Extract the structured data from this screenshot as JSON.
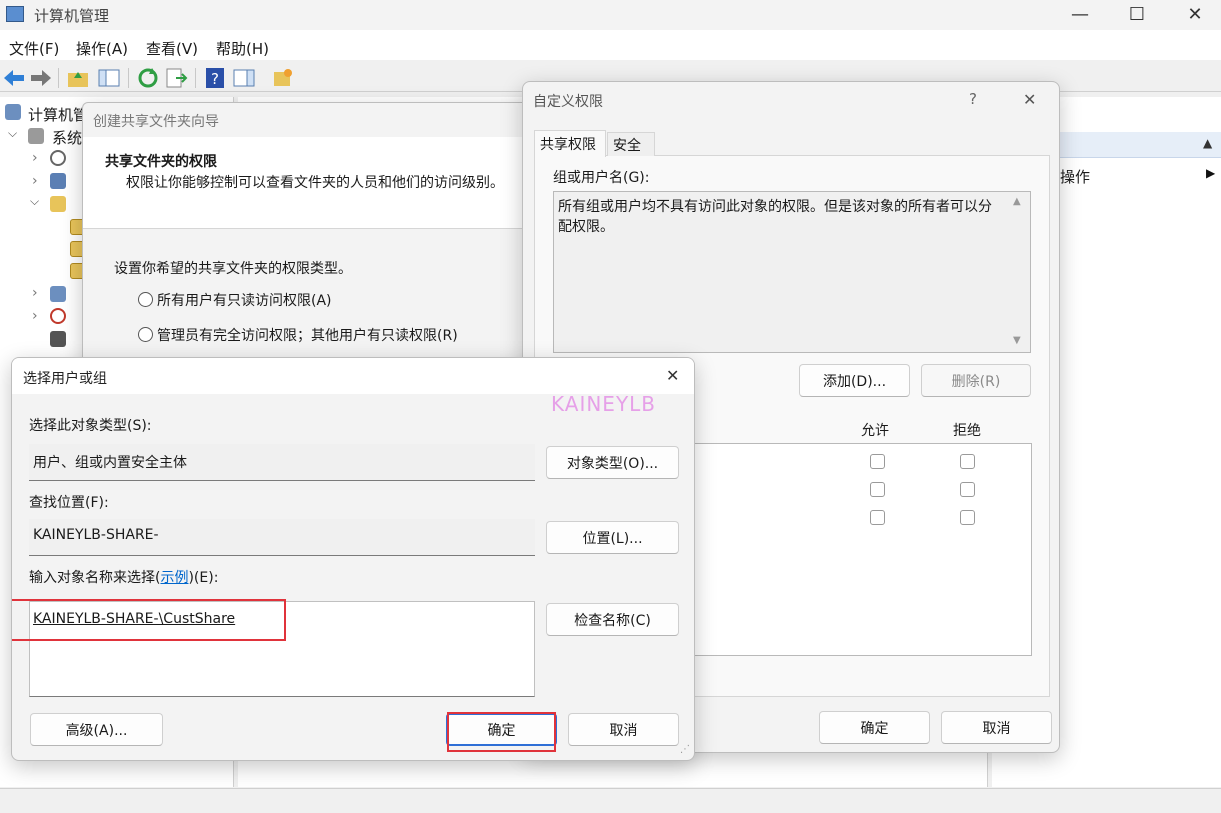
{
  "window": {
    "title": "计算机管理",
    "minimize": "—",
    "maximize": "☐",
    "close": "✕"
  },
  "menu": [
    "文件(F)",
    "操作(A)",
    "查看(V)",
    "帮助(H)"
  ],
  "tree": {
    "root": "计算机管",
    "system": "系统"
  },
  "right_pane": {
    "actions": "操作"
  },
  "wizard": {
    "title": "创建共享文件夹向导",
    "heading": "共享文件夹的权限",
    "subheading": "权限让你能够控制可以查看文件夹的人员和他们的访问级别。",
    "prompt": "设置你希望的共享文件夹的权限类型。",
    "options": [
      "所有用户有只读访问权限(A)",
      "管理员有完全访问权限；其他用户有只读权限(R)"
    ]
  },
  "perm": {
    "title": "自定义权限",
    "help": "?",
    "close": "✕",
    "tabs": [
      "共享权限",
      "安全"
    ],
    "group_label": "组或用户名(G):",
    "empty_msg": "所有组或用户均不具有访问此对象的权限。但是该对象的所有者可以分配权限。",
    "add": "添加(D)...",
    "remove": "删除(R)",
    "allow": "允许",
    "deny": "拒绝",
    "ok": "确定",
    "cancel": "取消"
  },
  "select": {
    "title": "选择用户或组",
    "close": "✕",
    "type_label": "选择此对象类型(S):",
    "type_value": "用户、组或内置安全主体",
    "type_btn": "对象类型(O)...",
    "loc_label": "查找位置(F):",
    "loc_value": "KAINEYLB-SHARE-",
    "loc_btn": "位置(L)...",
    "enter_label_a": "输入对象名称来选择(",
    "enter_link": "示例",
    "enter_label_b": ")(E):",
    "enter_value": "KAINEYLB-SHARE-\\CustShare",
    "check_btn": "检查名称(C)",
    "advanced": "高级(A)...",
    "ok": "确定",
    "cancel": "取消"
  },
  "watermark": "KAINEYLB",
  "colors": {
    "highlight": "#e0333b",
    "link": "#0066cc",
    "watermark": "#e6a0e8"
  }
}
